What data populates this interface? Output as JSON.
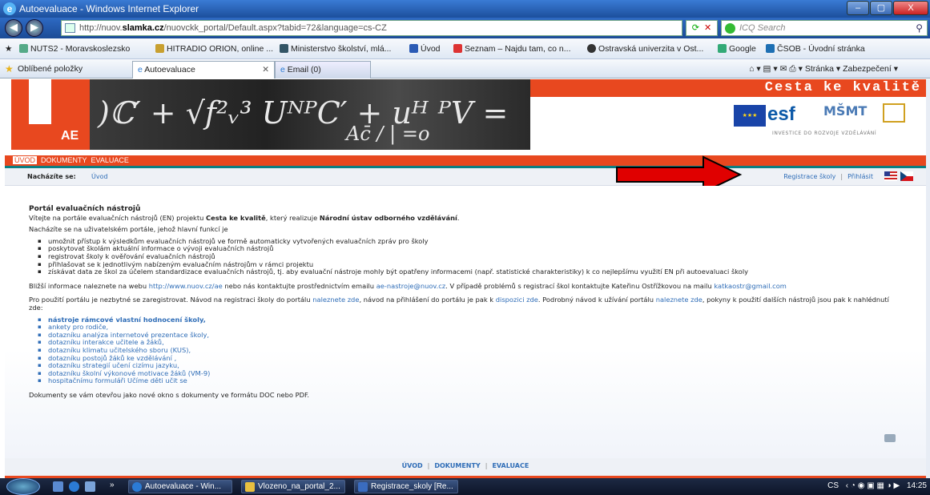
{
  "window": {
    "title": "Autoevaluace - Windows Internet Explorer",
    "minimize": "–",
    "maximize": "▢",
    "close": "X"
  },
  "address": {
    "url_prefix": "http://nuov.",
    "url_domain": "slamka.cz",
    "url_suffix": "/nuovckk_portal/Default.aspx?tabid=72&language=cs-CZ",
    "search_placeholder": "ICQ Search"
  },
  "favorites_bar": {
    "items": [
      "NUTS2 - Moravskoslezsko",
      "HITRADIO ORION, online ...",
      "Ministerstvo školství, mlá...",
      "Úvod",
      "Seznam – Najdu tam, co n...",
      "Ostravská univerzita v Ost...",
      "Google",
      "ČSOB - Úvodní stránka"
    ]
  },
  "tabs": {
    "favorites_label": "Oblíbené položky",
    "active": "Autoevaluace",
    "inactive": "Email (0)",
    "tools": "Stránka ▾   Zabezpečení ▾"
  },
  "banner": {
    "slogan": "Cesta ke kvalitě",
    "logo_text": "AE",
    "esf": "esf",
    "msmt": "MŠMT",
    "investment": "INVESTICE DO ROZVOJE VZDĚLÁVÁNÍ",
    "eu_caption": "EVROPSKÁ UNIE"
  },
  "menu": {
    "items": [
      "ÚVOD",
      "DOKUMENTY",
      "EVALUACE"
    ]
  },
  "breadcrumb": {
    "label": "Nacházíte se:",
    "current": "Úvod"
  },
  "account_links": {
    "register": "Registrace školy",
    "separator": "|",
    "login": "Přihlásit"
  },
  "content": {
    "heading": "Portál evaluačních nástrojů",
    "intro_pre": "Vítejte na portále evaluačních nástrojů (EN) projektu ",
    "intro_project": "Cesta ke kvalitě",
    "intro_mid": ", který realizuje ",
    "intro_org": "Národní ústav odborného vzdělávání",
    "intro_end": ".",
    "portal_desc": "Nacházíte se na uživatelském portále, jehož hlavní funkcí je",
    "functions": [
      "umožnit přístup k výsledkům evaluačních nástrojů ve formě automaticky vytvořených evaluačních zpráv pro školy",
      "poskytovat školám aktuální informace o vývoji evaluačních nástrojů",
      "registrovat školy k ověřování evaluačních nástrojů",
      "přihlašovat se k jednotlivým nabízeným evaluačním nástrojům v rámci projektu",
      "získávat data ze škol za účelem standardizace evaluačních nástrojů, tj. aby evaluační nástroje mohly být opatřeny informacemi (např. statistické charakteristiky) k co nejlepšímu využití EN při autoevaluaci školy"
    ],
    "info_pre": "Bližší informace naleznete na webu ",
    "info_web": "http://www.nuov.cz/ae",
    "info_mid": " nebo nás kontaktujte prostřednictvím emailu ",
    "info_email": "ae-nastroje@nuov.cz",
    "info_post": ". V případě problémů s registrací škol kontaktujte Kateřinu Ostřížkovou na mailu ",
    "info_email2": "katkaostr@gmail.com",
    "reg_pre": "Pro použití portálu je nezbytné se zaregistrovat. Návod na registraci školy do portálu ",
    "reg_link1": "naleznete zde",
    "reg_mid1": ", návod na přihlášení do portálu je pak k ",
    "reg_link2": "dispozici zde",
    "reg_mid2": ". Podrobný návod k užívání portálu ",
    "reg_link3": "naleznete zde",
    "reg_post": ", pokyny k použití dalších nástrojů jsou pak k nahlédnutí zde:",
    "tools": [
      "nástroje rámcové vlastní hodnocení školy,",
      "ankety pro rodiče,",
      "dotazníku analýza internetové prezentace školy,",
      "dotazníku interakce učitele a žáků,",
      "dotazníku klimatu učitelského sboru (KUS),",
      "dotazníku postojů žáků ke vzdělávání ,",
      "dotazníku strategií učení cizímu jazyku,",
      "dotazníku školní výkonové motivace žáků (VM-9)",
      "hospitačnímu formuláři Učíme děti učit se"
    ],
    "docs_note": "Dokumenty se vám otevřou jako nové okno s dokumenty ve formátu DOC nebo PDF."
  },
  "footer": {
    "items": [
      "ÚVOD",
      "DOKUMENTY",
      "EVALUACE"
    ],
    "separator": "|"
  },
  "taskbar": {
    "buttons": [
      "Autoevaluace - Win...",
      "Vlozeno_na_portal_2...",
      "Registrace_skoly [Re..."
    ],
    "lang": "CS",
    "clock": "14:25"
  },
  "colors": {
    "brand_red": "#e8481f",
    "teal": "#0b7f83",
    "link_blue": "#2f6db7",
    "arrow_red": "#e00000"
  }
}
